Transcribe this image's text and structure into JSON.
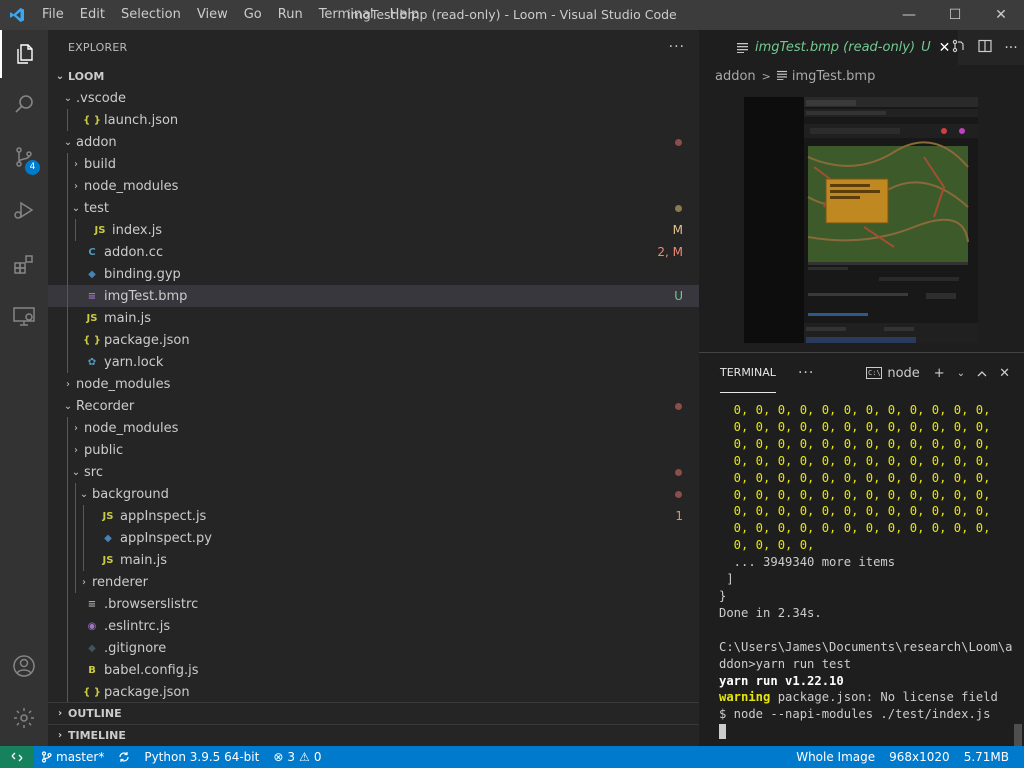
{
  "window": {
    "title": "imgTest.bmp (read-only) - Loom - Visual Studio Code",
    "menu": [
      "File",
      "Edit",
      "Selection",
      "View",
      "Go",
      "Run",
      "Terminal",
      "Help"
    ],
    "controls": {
      "minimize": "—",
      "maximize": "☐",
      "close": "✕"
    }
  },
  "activity_bar": {
    "items": [
      "explorer-icon",
      "search-icon",
      "source-control-icon",
      "run-debug-icon",
      "extensions-icon",
      "remote-explorer-icon"
    ],
    "source_control_badge": "4",
    "bottom": [
      "account-icon",
      "manage-gear-icon"
    ]
  },
  "sidebar": {
    "title": "EXPLORER",
    "more": "···",
    "root": "LOOM",
    "tree": [
      {
        "label": ".vscode",
        "type": "folder",
        "open": true,
        "depth": 1
      },
      {
        "label": "launch.json",
        "type": "json",
        "depth": 2
      },
      {
        "label": "addon",
        "type": "folder",
        "open": true,
        "depth": 1,
        "color": "err",
        "dot": true
      },
      {
        "label": "build",
        "type": "folder",
        "open": false,
        "depth": 2,
        "color": "ign"
      },
      {
        "label": "node_modules",
        "type": "folder",
        "open": false,
        "depth": 2,
        "color": "ign"
      },
      {
        "label": "test",
        "type": "folder",
        "open": true,
        "depth": 2,
        "color": "mod",
        "dot": true
      },
      {
        "label": "index.js",
        "type": "js",
        "depth": 3,
        "color": "mod",
        "status": "M"
      },
      {
        "label": "addon.cc",
        "type": "cpp",
        "depth": 2,
        "color": "err",
        "status": "2, M"
      },
      {
        "label": "binding.gyp",
        "type": "py",
        "depth": 2
      },
      {
        "label": "imgTest.bmp",
        "type": "img",
        "depth": 2,
        "color": "new",
        "status": "U",
        "selected": true
      },
      {
        "label": "main.js",
        "type": "js",
        "depth": 2
      },
      {
        "label": "package.json",
        "type": "json",
        "depth": 2
      },
      {
        "label": "yarn.lock",
        "type": "yarn",
        "depth": 2
      },
      {
        "label": "node_modules",
        "type": "folder",
        "open": false,
        "depth": 1,
        "color": "ign"
      },
      {
        "label": "Recorder",
        "type": "folder",
        "open": true,
        "depth": 1,
        "color": "err",
        "dot": true
      },
      {
        "label": "node_modules",
        "type": "folder",
        "open": false,
        "depth": 2,
        "color": "ign"
      },
      {
        "label": "public",
        "type": "folder",
        "open": false,
        "depth": 2
      },
      {
        "label": "src",
        "type": "folder",
        "open": true,
        "depth": 2,
        "color": "err",
        "dot": true
      },
      {
        "label": "background",
        "type": "folder",
        "open": true,
        "depth": 3,
        "color": "err",
        "dot": true
      },
      {
        "label": "appInspect.js",
        "type": "js",
        "depth": 4,
        "color": "err",
        "status": "1"
      },
      {
        "label": "appInspect.py",
        "type": "py",
        "depth": 4
      },
      {
        "label": "main.js",
        "type": "js",
        "depth": 4
      },
      {
        "label": "renderer",
        "type": "folder",
        "open": false,
        "depth": 3
      },
      {
        "label": ".browserslistrc",
        "type": "lines",
        "depth": 2
      },
      {
        "label": ".eslintrc.js",
        "type": "eslint",
        "depth": 2
      },
      {
        "label": ".gitignore",
        "type": "git",
        "depth": 2
      },
      {
        "label": "babel.config.js",
        "type": "babel",
        "depth": 2
      },
      {
        "label": "package.json",
        "type": "json",
        "depth": 2
      }
    ],
    "sections": [
      "OUTLINE",
      "TIMELINE"
    ]
  },
  "editor": {
    "tab": {
      "label": "imgTest.bmp (read-only)",
      "status": "U",
      "close": "✕"
    },
    "actions": [
      "open-changes-icon",
      "split-editor-icon",
      "more-actions-icon"
    ],
    "breadcrumb": [
      "addon",
      "imgTest.bmp"
    ]
  },
  "panel": {
    "tab": "TERMINAL",
    "more": "···",
    "shell": "node",
    "lines": [
      {
        "text": "  0, 0, 0, 0, 0, 0, 0, 0, 0, 0, 0, 0,",
        "style": "yellow"
      },
      {
        "text": "  0, 0, 0, 0, 0, 0, 0, 0, 0, 0, 0, 0,",
        "style": "yellow"
      },
      {
        "text": "  0, 0, 0, 0, 0, 0, 0, 0, 0, 0, 0, 0,",
        "style": "yellow"
      },
      {
        "text": "  0, 0, 0, 0, 0, 0, 0, 0, 0, 0, 0, 0,",
        "style": "yellow"
      },
      {
        "text": "  0, 0, 0, 0, 0, 0, 0, 0, 0, 0, 0, 0,",
        "style": "yellow"
      },
      {
        "text": "  0, 0, 0, 0, 0, 0, 0, 0, 0, 0, 0, 0,",
        "style": "yellow"
      },
      {
        "text": "  0, 0, 0, 0, 0, 0, 0, 0, 0, 0, 0, 0,",
        "style": "yellow"
      },
      {
        "text": "  0, 0, 0, 0, 0, 0, 0, 0, 0, 0, 0, 0,",
        "style": "yellow"
      },
      {
        "text": "  0, 0, 0, 0,",
        "style": "yellow"
      },
      {
        "text": "  ... 3949340 more items",
        "style": "plain"
      },
      {
        "text": " ]",
        "style": "plain"
      },
      {
        "text": "}",
        "style": "plain"
      },
      {
        "text": "Done in 2.34s.",
        "style": "plain"
      },
      {
        "text": "",
        "style": "plain"
      },
      {
        "text": "C:\\Users\\James\\Documents\\research\\Loom\\a",
        "style": "plain"
      },
      {
        "text": "ddon>yarn run test",
        "style": "plain"
      },
      {
        "text": "yarn run v1.22.10",
        "style": "bold"
      },
      {
        "text": "warning",
        "rest": " package.json: No license field",
        "style": "warning"
      },
      {
        "text": "$ node --napi-modules ./test/index.js",
        "style": "plain"
      }
    ]
  },
  "statusbar": {
    "branch": "master*",
    "python": "Python 3.9.5 64-bit",
    "errors": "3",
    "warnings": "0",
    "right": [
      "Whole Image",
      "968x1020",
      "5.71MB"
    ]
  }
}
